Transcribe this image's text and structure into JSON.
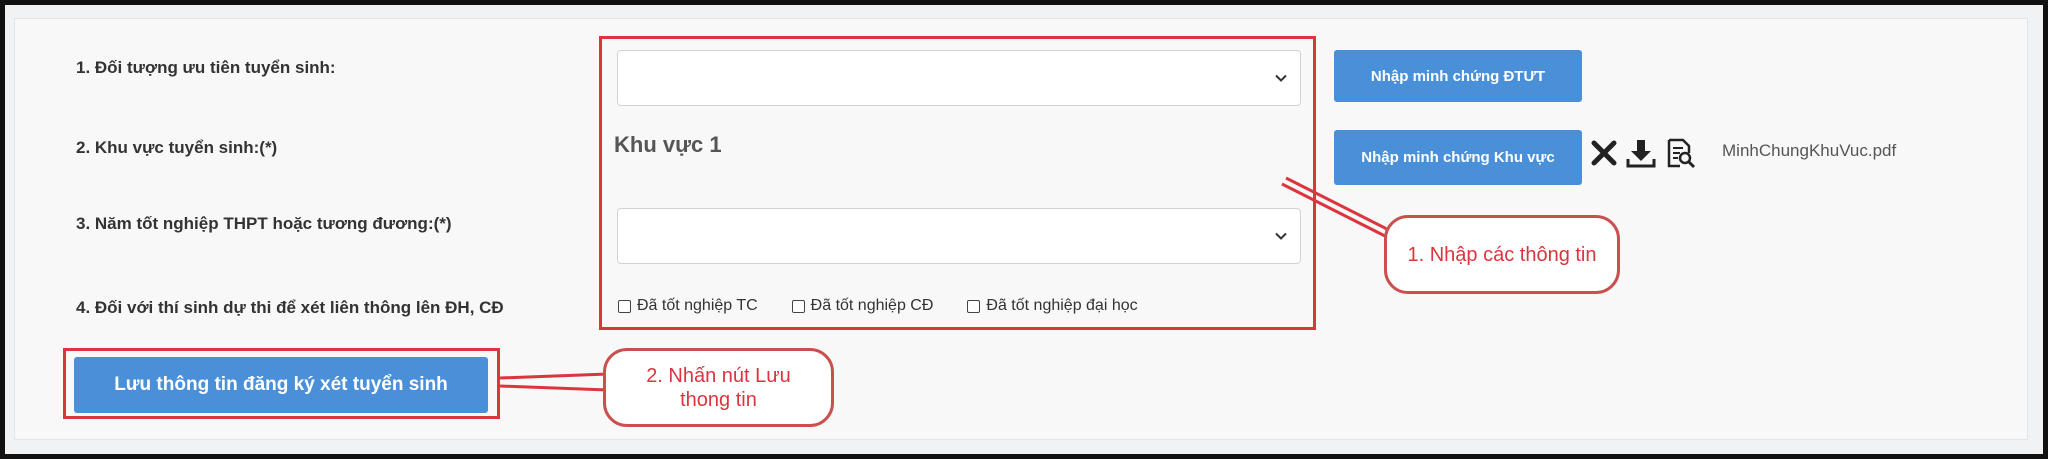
{
  "form": {
    "field1_label": "1. Đối tượng ưu tiên tuyển sinh:",
    "field2_label": "2. Khu vực tuyển sinh:(*)",
    "field3_label": "3. Năm tốt nghiệp THPT hoặc tương đương:(*)",
    "field4_label": "4. Đối với thí sinh dự thi để xét liên thông lên ĐH, CĐ",
    "field1_value": "",
    "field2_value": "Khu vực 1",
    "field3_value": "",
    "checkboxes": [
      {
        "label": "Đã tốt nghiệp TC",
        "checked": false
      },
      {
        "label": "Đã tốt nghiệp CĐ",
        "checked": false
      },
      {
        "label": "Đã tốt nghiệp đại học",
        "checked": false
      }
    ],
    "btn_evidence_dtut": "Nhập minh chứng ĐTƯT",
    "btn_evidence_khuvuc": "Nhập minh chứng Khu vực",
    "file_name": "MinhChungKhuVuc.pdf",
    "save_button": "Lưu thông tin đăng ký xét tuyển sinh"
  },
  "annotations": {
    "callout1": "1. Nhập các thông tin",
    "callout2": "2. Nhấn nút Lưu thong tin"
  },
  "icons": [
    "delete-icon",
    "download-icon",
    "view-document-icon",
    "chevron-down-icon"
  ],
  "colors": {
    "accent": "#4a90d9",
    "annotation": "#d9363e"
  }
}
